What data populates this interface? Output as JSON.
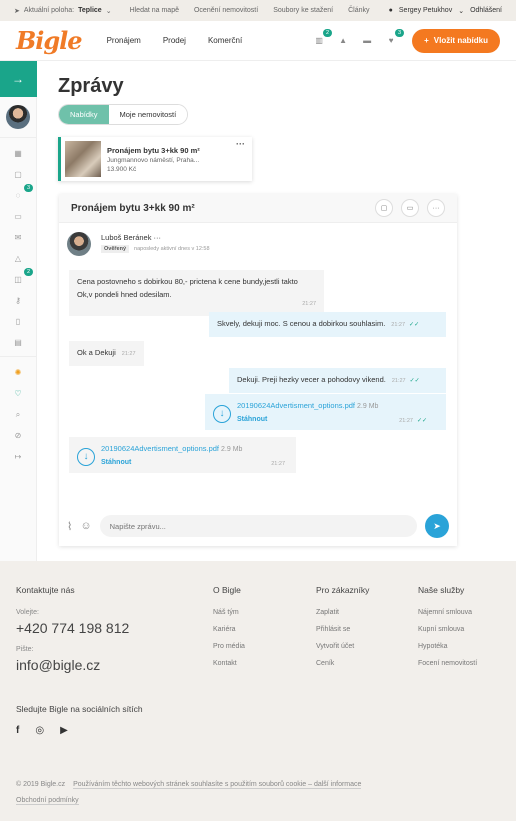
{
  "topbar": {
    "location_label": "Aktuální poloha:",
    "location_value": "Teplice",
    "links": [
      "Hledat na mapě",
      "Ocenění nemovitostí",
      "Soubory ke stažení",
      "Články"
    ],
    "user_name": "Sergey Petukhov",
    "logout": "Odhlášení"
  },
  "header": {
    "logo": "Bigle",
    "nav": [
      "Pronájem",
      "Prodej",
      "Komerční"
    ],
    "badges": {
      "stats": "2",
      "likes": "3"
    },
    "add_button": "Vložit nabídku"
  },
  "sidebar": {
    "badges": {
      "messages": "3",
      "notes": "2"
    }
  },
  "page": {
    "title": "Zprávy",
    "tabs": [
      "Nabídky",
      "Moje nemovitostí"
    ]
  },
  "offer": {
    "title": "Pronájem bytu 3+kk 90 m²",
    "address": "Jungmannovo náměstí, Praha...",
    "price": "13.900 Kč",
    "more": "···"
  },
  "chat": {
    "title": "Pronájem bytu 3+kk 90 m²",
    "person_name": "Luboš Beránek",
    "person_more": "···",
    "verified": "Ověřený",
    "last_active": "naposledy aktivní dnes v 12:58",
    "messages": [
      {
        "text1": "Cena postovneho s dobirkou 80,- prictena k cene bundy,jestli takto",
        "text2": "Ok,v pondeli hned odesilam.",
        "time": "21:27"
      },
      {
        "text": "Skvely, dekuji moc. S cenou a dobirkou souhlasim.",
        "time": "21:27"
      },
      {
        "text": "Ok a Dekuji",
        "time": "21:27"
      },
      {
        "text": "Dekuji. Preji hezky vecer a pohodovy vikend.",
        "time": "21:27"
      }
    ],
    "files": [
      {
        "name": "20190624Advertisment_options.pdf",
        "size": "2.9 Mb",
        "download": "Stáhnout",
        "time": "21:27"
      },
      {
        "name": "20190624Advertisment_options.pdf",
        "size": "2.9 Mb",
        "download": "Stáhnout",
        "time": "21:27"
      }
    ],
    "input_placeholder": "Napište zprávu..."
  },
  "footer": {
    "contact_title": "Kontaktujte nás",
    "phone_label": "Volejte:",
    "phone": "+420 774 198 812",
    "email_label": "Pište:",
    "email": "info@bigle.cz",
    "social_title": "Sledujte Bigle na sociálních sítích",
    "cols": [
      {
        "title": "O Bigle",
        "links": [
          "Náš tým",
          "Kariéra",
          "Pro média",
          "Kontakt"
        ]
      },
      {
        "title": "Pro zákazníky",
        "links": [
          "Zaplatit",
          "Přihlásit se",
          "Vytvořit účet",
          "Ceník"
        ]
      },
      {
        "title": "Naše služby",
        "links": [
          "Nájemní smlouva",
          "Kupní smlouva",
          "Hypotéka",
          "Focení nemovitostí"
        ]
      }
    ],
    "copyright": "© 2019 Bigle.cz",
    "cookies": "Používáním těchto webových stránek souhlasíte s použitím souborů cookie – další informace",
    "terms": "Obchodní podmínky"
  }
}
